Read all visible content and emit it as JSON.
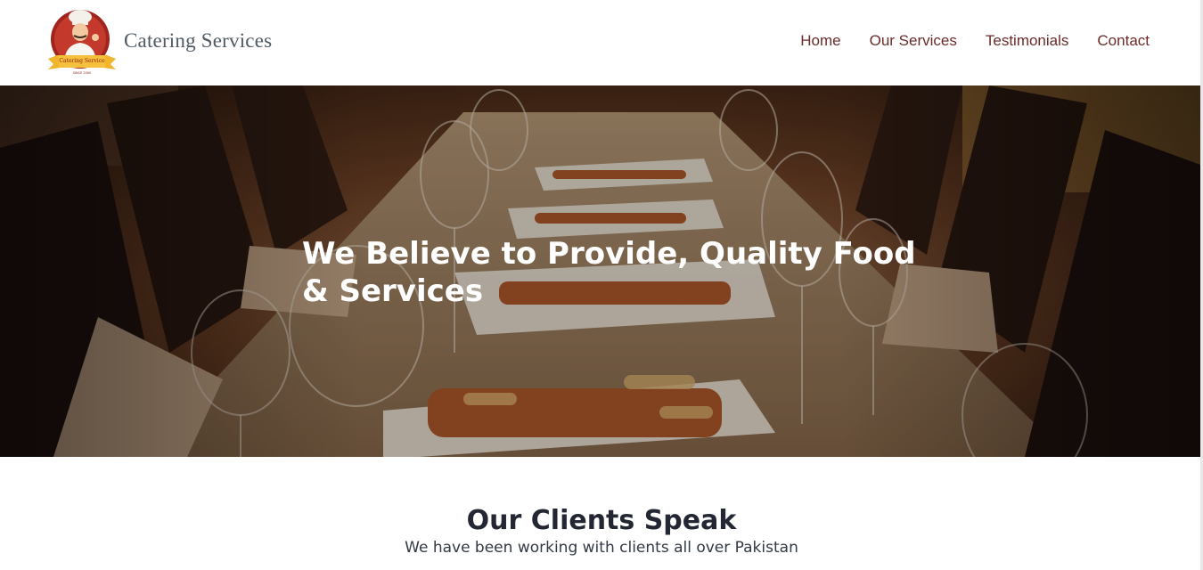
{
  "header": {
    "brand": "Catering Services",
    "logo_text": "Catering Service",
    "logo_subtext": "SINCE 2000",
    "nav": [
      {
        "label": "Home"
      },
      {
        "label": "Our Services"
      },
      {
        "label": "Testimonials"
      },
      {
        "label": "Contact"
      }
    ]
  },
  "hero": {
    "title": "We Believe to Provide, Quality Food & Services"
  },
  "clients": {
    "title": "Our Clients Speak",
    "subtitle": "We have been working with clients all over Pakistan"
  },
  "colors": {
    "nav_text": "#6b2b2b",
    "brand_text": "#4f5a63",
    "hero_overlay": "#2a170c"
  }
}
